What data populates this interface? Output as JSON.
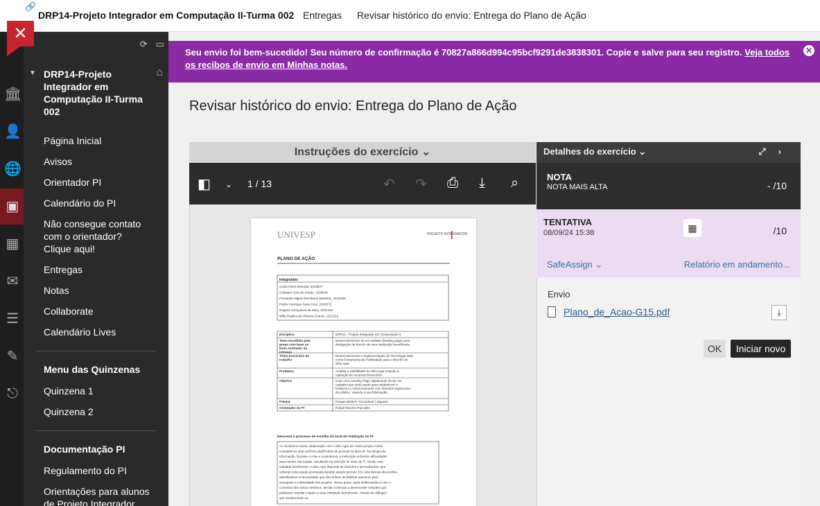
{
  "topbar": {
    "course": "DRP14-Projeto Integrador em Computação II-Turma 002",
    "crumb1": "Entregas",
    "crumb2": "Revisar histórico do envio: Entrega do Plano de Ação"
  },
  "nav": {
    "course_title": "DRP14-Projeto Integrador em Computação II-Turma 002",
    "items": [
      "Página Inicial",
      "Avisos",
      "Orientador PI",
      "Calendário do PI",
      "Não consegue contato com o orientador? Clique aqui!",
      "Entregas",
      "Notas",
      "Collaborate",
      "Calendário Lives"
    ],
    "section1": "Menu das Quinzenas",
    "section1_items": [
      "Quinzena 1",
      "Quinzena 2"
    ],
    "section2": "Documentação PI",
    "section2_items": [
      "Regulamento do PI",
      "Orientações para alunos de Projeto Integrador"
    ]
  },
  "banner": {
    "text": "Seu envio foi bem-sucedido! Seu número de confirmação é 70827a866d994c95bcf9291de3838301. Copie e salve para seu registro.",
    "link": "Veja todos os recibos de envio em Minhas notas."
  },
  "page_title": "Revisar histórico do envio: Entrega do Plano de Ação",
  "viewer": {
    "header": "Instruções do exercício",
    "pages": "1 / 13"
  },
  "paper": {
    "logo": "UNIVESP",
    "brand": "PROJETO INTEGRADOR",
    "heading": "PLANO DE AÇÃO",
    "integrantes_label": "Integrantes",
    "integrantes": [
      "Cintia Izumi Shinoda, 2210847",
      "Cristiano Gois de Araújo, 2106038",
      "Fernando Miguel Escribano Martinez, 2216189",
      "Pedro Henrique Faria Cruz, 2202072",
      "Rogerio Gonçalves da Silva, 2231346",
      "Willy Paulino de Oliveira Gomes, 2221112"
    ],
    "rows": [
      {
        "k": "Disciplina",
        "v": "DRP14 - Projeto Integrador em Computação II"
      },
      {
        "k": "Tema escolhido pelo grupo com base no tema norteador da Univesp",
        "v": "Desenvolvimento de um website (landing page) para divulgação do brechó de uma instituição beneficente."
      },
      {
        "k": "Título provisório do trabalho",
        "v": "Desenvolvimento e Implementação de Tecnologia Web como Ferramenta de Publicidade para o Brechó do Sítio Agar"
      },
      {
        "k": "Problema",
        "v": "Ampliar a visibilidade do Sítio Agar visando a captação de recursos financeiros"
      },
      {
        "k": "Objetivo",
        "v": "Criar uma Landing Page objetivando iniciar um cadastro que será usado para estabelecer e fortalecer o relacionamento com diversos segmentos de público, visando a sua fidelização."
      },
      {
        "k": "Polo(s)",
        "v": "Parque Bristol | Aricanduva | Jaguaré"
      },
      {
        "k": "Orientador do PI",
        "v": "Rafael Mazzini Ramalho"
      }
    ],
    "section2_title": "Descreva o processo de escolha do local de realização do PI.",
    "section2_text": "Ao iniciarmos nossa colaboração com o Sítio Agar em nosso projeto inicial, constatamos uma carência significativa de pessoal na área de Tecnologia da Informação. Durante a crise e a pandemia, a instituição enfrentou dificuldades para manter sua equipe, resultando na extinção do setor de TI. Sendo uma entidade beneficente, o Sítio Agar depende de doações e arrecadações, que sofreram uma queda acentuada durante aquele período. Em uma dessas discussões, identificamos a necessidade que eles tinham de fidelizar parceiros para assegurar a continuidade dos projetos. Nosso grupo, após deliberações e com o consenso dos novos membros, decidiu continuar a desenvolver soluções que pudessem ampliar o apoio a essa instituição beneficente. Através de diálogos que esclareceram as"
  },
  "details": {
    "header": "Detalhes do exercício",
    "nota_label": "NOTA",
    "nota_sub": "NOTA MAIS ALTA",
    "nota_value": "- /10",
    "tentativa_label": "TENTATIVA",
    "tentativa_date": "08/09/24 15:38",
    "tentativa_value": "/10",
    "safeassign": "SafeAssign",
    "relatorio": "Relatório em andamento...",
    "envio_label": "Envio",
    "file_name": "Plano_de_Acao-G15.pdf",
    "ok": "OK",
    "iniciar": "Iniciar novo"
  }
}
